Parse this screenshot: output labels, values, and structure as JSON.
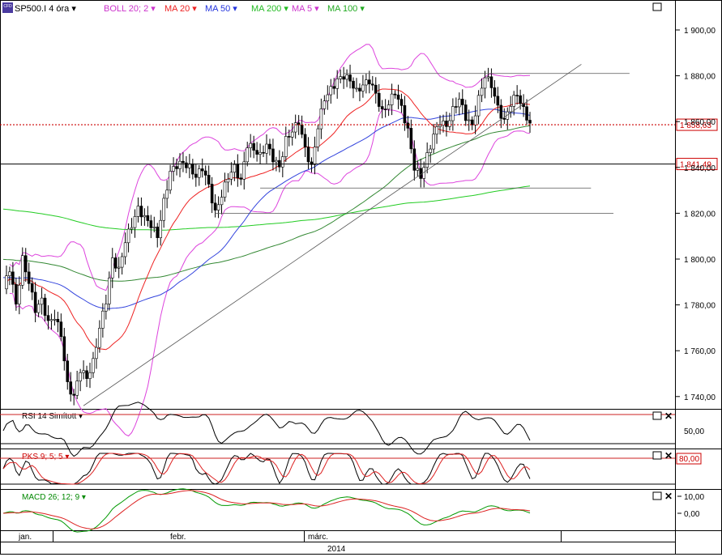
{
  "header": {
    "cfd_badge": "CFD",
    "symbol": "SP500.I",
    "timeframe": "4 óra",
    "indicators": [
      {
        "label": "BOLL 20; 2",
        "color": "#cc33cc"
      },
      {
        "label": "MA 20",
        "color": "#ee2222"
      },
      {
        "label": "MA 50",
        "color": "#2233dd"
      },
      {
        "label": "MA 200",
        "color": "#22bb22"
      },
      {
        "label": "MA 5",
        "color": "#cc33cc"
      },
      {
        "label": "MA 100",
        "color": "#22aa22"
      }
    ]
  },
  "price_axis": {
    "ticks": [
      "1 900,00",
      "1 880,00",
      "1 860,00",
      "1 840,00",
      "1 820,00",
      "1 800,00",
      "1 780,00",
      "1 760,00",
      "1 740,00"
    ],
    "current_price": "1 858,63",
    "level_label": "1 841,49"
  },
  "rsi": {
    "label": "RSI 14 Simított",
    "tick": "50,00",
    "color": "#000000"
  },
  "stoch": {
    "label": "PKS 9; 5; 5",
    "tick": "80,00",
    "color": "#cc0000"
  },
  "macd": {
    "label": "MACD 26; 12; 9",
    "ticks": [
      "10,00",
      "0,00"
    ],
    "color": "#008800"
  },
  "time_axis": {
    "months": [
      "jan.",
      "febr.",
      "márc."
    ],
    "year": "2014"
  },
  "chart_data": {
    "type": "candlestick",
    "symbol": "SP500.I",
    "timeframe": "4 óra",
    "x_axis": [
      "jan.",
      "febr.",
      "márc."
    ],
    "year": "2014",
    "ylim": [
      1734,
      1908
    ],
    "close_path": [
      [
        0,
        1787
      ],
      [
        2,
        1796
      ],
      [
        4,
        1780
      ],
      [
        6,
        1800
      ],
      [
        8,
        1790
      ],
      [
        10,
        1778
      ],
      [
        12,
        1782
      ],
      [
        14,
        1772
      ],
      [
        16,
        1775
      ],
      [
        18,
        1767
      ],
      [
        20,
        1745
      ],
      [
        22,
        1740
      ],
      [
        24,
        1752
      ],
      [
        26,
        1748
      ],
      [
        28,
        1755
      ],
      [
        30,
        1770
      ],
      [
        32,
        1782
      ],
      [
        34,
        1800
      ],
      [
        36,
        1795
      ],
      [
        38,
        1808
      ],
      [
        40,
        1815
      ],
      [
        42,
        1822
      ],
      [
        44,
        1818
      ],
      [
        46,
        1815
      ],
      [
        48,
        1810
      ],
      [
        50,
        1825
      ],
      [
        52,
        1838
      ],
      [
        54,
        1841
      ],
      [
        56,
        1842
      ],
      [
        58,
        1840
      ],
      [
        60,
        1836
      ],
      [
        62,
        1840
      ],
      [
        64,
        1832
      ],
      [
        66,
        1820
      ],
      [
        68,
        1828
      ],
      [
        70,
        1836
      ],
      [
        72,
        1840
      ],
      [
        74,
        1834
      ],
      [
        76,
        1850
      ],
      [
        78,
        1848
      ],
      [
        80,
        1845
      ],
      [
        82,
        1850
      ],
      [
        84,
        1844
      ],
      [
        86,
        1840
      ],
      [
        88,
        1852
      ],
      [
        90,
        1856
      ],
      [
        92,
        1860
      ],
      [
        94,
        1848
      ],
      [
        96,
        1840
      ],
      [
        98,
        1858
      ],
      [
        100,
        1870
      ],
      [
        102,
        1874
      ],
      [
        104,
        1878
      ],
      [
        106,
        1880
      ],
      [
        108,
        1878
      ],
      [
        110,
        1873
      ],
      [
        112,
        1876
      ],
      [
        114,
        1878
      ],
      [
        116,
        1872
      ],
      [
        118,
        1864
      ],
      [
        120,
        1868
      ],
      [
        122,
        1873
      ],
      [
        124,
        1866
      ],
      [
        126,
        1856
      ],
      [
        128,
        1840
      ],
      [
        130,
        1836
      ],
      [
        132,
        1845
      ],
      [
        134,
        1854
      ],
      [
        136,
        1860
      ],
      [
        138,
        1858
      ],
      [
        140,
        1865
      ],
      [
        142,
        1870
      ],
      [
        144,
        1862
      ],
      [
        146,
        1858
      ],
      [
        148,
        1870
      ],
      [
        150,
        1880
      ],
      [
        152,
        1876
      ],
      [
        154,
        1866
      ],
      [
        156,
        1860
      ],
      [
        158,
        1868
      ],
      [
        160,
        1872
      ],
      [
        162,
        1865
      ],
      [
        164,
        1859
      ]
    ],
    "reference_levels": [
      {
        "value": 1858.63,
        "label": "1 858,63"
      },
      {
        "value": 1841.49,
        "label": "1 841,49"
      }
    ]
  }
}
